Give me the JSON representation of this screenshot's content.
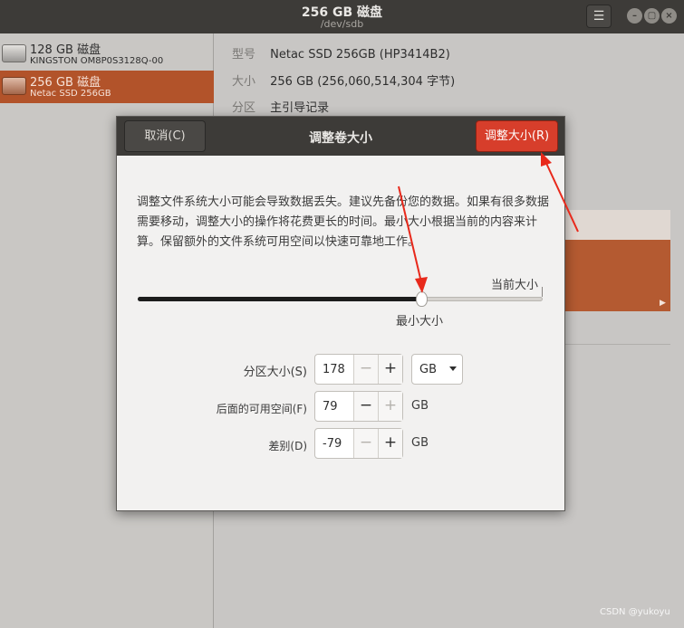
{
  "window": {
    "title": "256 GB 磁盘",
    "subtitle": "/dev/sdb",
    "menu_icon": "hamburger-icon",
    "menu_glyph": "☰",
    "minimize_glyph": "–",
    "maximize_glyph": "▢",
    "close_glyph": "×"
  },
  "sidebar": {
    "disks": [
      {
        "name": "128 GB 磁盘",
        "model": "KINGSTON OM8P0S3128Q-00"
      },
      {
        "name": "256 GB 磁盘",
        "model": "Netac SSD 256GB"
      }
    ]
  },
  "details": {
    "model_label": "型号",
    "model_value": "Netac SSD 256GB (HP3414B2)",
    "size_label": "大小",
    "size_value": "256 GB (256,060,514,304 字节)",
    "partitioning_label": "分区",
    "partitioning_value": "主引导记录"
  },
  "dialog": {
    "cancel_label": "取消(C)",
    "title": "调整卷大小",
    "resize_label": "调整大小(R)",
    "description": "调整文件系统大小可能会导致数据丢失。建议先备份您的数据。如果有很多数据需要移动，调整大小的操作将花费更长的时间。最小大小根据当前的内容来计算。保留额外的文件系统可用空间以快速可靠地工作。",
    "slider": {
      "current_label": "当前大小",
      "min_label": "最小大小",
      "value_fraction": 0.7
    },
    "fields": {
      "partition_size_label": "分区大小(S)",
      "partition_size_value": "178",
      "free_after_label": "后面的可用空间(F)",
      "free_after_value": "79",
      "difference_label": "差别(D)",
      "difference_value": "-79",
      "unit_selected": "GB",
      "unit_label": "GB",
      "minus_glyph": "−",
      "plus_glyph": "+"
    }
  },
  "annotation_color": "#e8291b",
  "watermark": "CSDN @yukoyu"
}
